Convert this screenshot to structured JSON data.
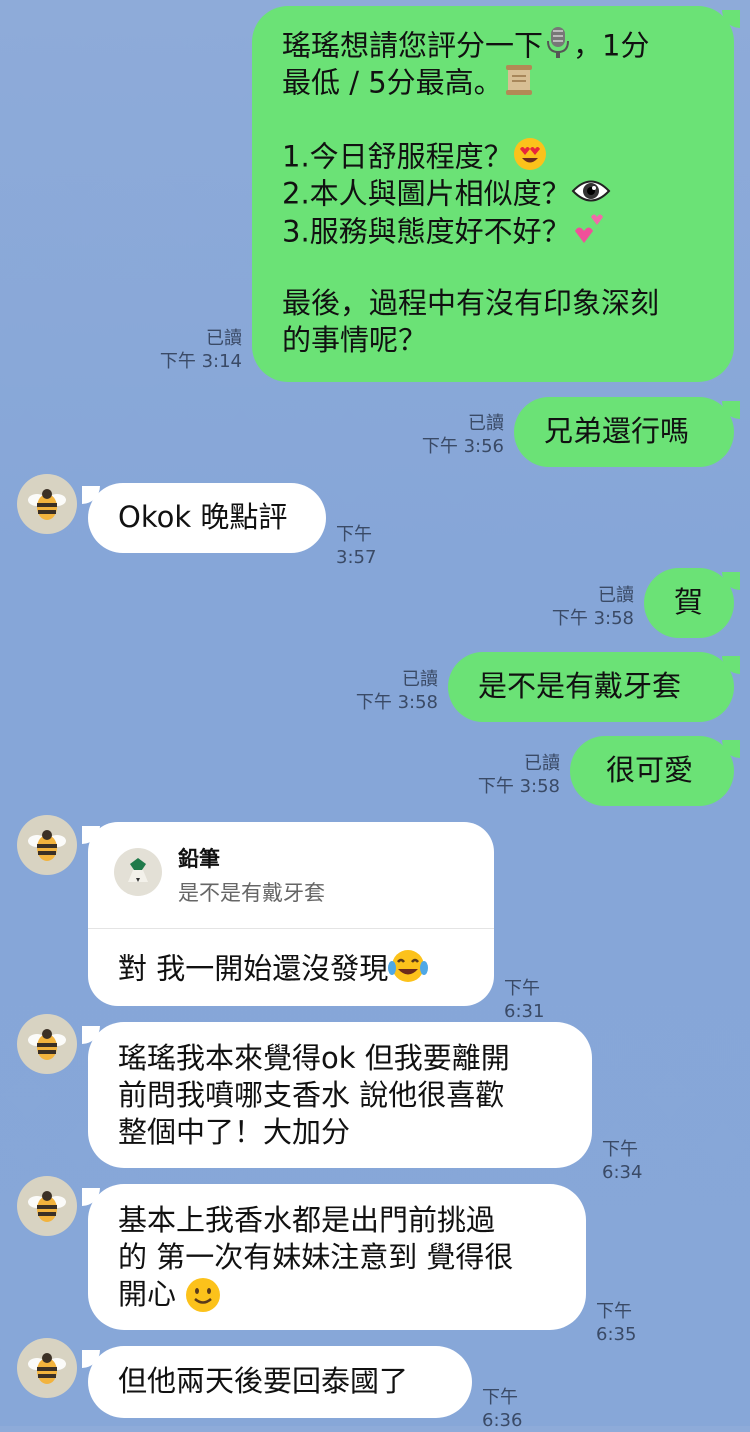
{
  "messages": {
    "m1": {
      "line1": "瑤瑤想請您評分一下",
      "line1b": "，1分",
      "line2": "最低 / 5分最高。",
      "q1": "1.今日舒服程度？",
      "q2": "2.本人與圖片相似度？",
      "q3": "3.服務與態度好不好？",
      "last1": "最後，過程中有沒有印象深刻",
      "last2": "的事情呢？",
      "read": "已讀",
      "time": "下午 3:14"
    },
    "m2": {
      "text": "兄弟還行嗎",
      "read": "已讀",
      "time": "下午 3:56"
    },
    "m3": {
      "text": "Okok 晚點評",
      "time": "下午 3:57"
    },
    "m4": {
      "text": "賀",
      "read": "已讀",
      "time": "下午 3:58"
    },
    "m5": {
      "text": "是不是有戴牙套",
      "read": "已讀",
      "time": "下午 3:58"
    },
    "m6": {
      "text": "很可愛",
      "read": "已讀",
      "time": "下午 3:58"
    },
    "m7": {
      "reply_name": "鉛筆",
      "reply_text": "是不是有戴牙套",
      "text": "對 我一開始還沒發現",
      "time": "下午 6:31"
    },
    "m8": {
      "text": "瑤瑤我本來覺得ok  但我要離開\n前問我噴哪支香水 說他很喜歡\n整個中了！大加分",
      "time": "下午 6:34"
    },
    "m9": {
      "text": "基本上我香水都是出門前挑過\n的 第一次有妹妹注意到 覺得很\n開心",
      "time": "下午 6:35"
    },
    "m10": {
      "text": "但他兩天後要回泰國了",
      "time": "下午 6:36"
    }
  },
  "colors": {
    "outgoing_bubble": "#6be276",
    "incoming_bubble": "#ffffff",
    "background": "#87a7d8"
  },
  "icons": [
    "microphone-emoji",
    "scroll-emoji",
    "heart-eyes-emoji",
    "eye-emoji",
    "two-hearts-emoji",
    "joy-emoji",
    "smile-emoji",
    "bee-avatar",
    "pencil-avatar"
  ]
}
